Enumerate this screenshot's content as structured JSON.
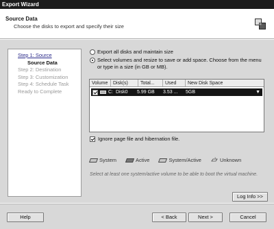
{
  "window": {
    "title": "Export Wizard"
  },
  "header": {
    "title": "Source Data",
    "subtitle": "Choose the disks to export and specify their size",
    "logo_icon": "wizard-logo-icon"
  },
  "steps": [
    {
      "label": "Step 1: Source",
      "state": "link"
    },
    {
      "label": "Source Data",
      "state": "current"
    },
    {
      "label": "Step 2: Destination",
      "state": "disabled"
    },
    {
      "label": "Step 3: Customization",
      "state": "disabled"
    },
    {
      "label": "Step 4: Schedule Task",
      "state": "disabled"
    },
    {
      "label": "Ready to Complete",
      "state": "disabled"
    }
  ],
  "options": {
    "export_all": {
      "label": "Export all disks and maintain size",
      "selected": false
    },
    "select_volumes": {
      "label": "Select volumes and resize to save or add space. Choose from the menu or type in a size (in GB or MB).",
      "selected": true
    }
  },
  "volume_table": {
    "columns": [
      "Volume",
      "Disk(s)",
      "Total...",
      "Used",
      "New Disk Space"
    ],
    "rows": [
      {
        "volume": "C:",
        "disk": "Disk0",
        "total": "5.99 GB",
        "used": "3.53 ...",
        "new_space": "5GB",
        "checked": true
      }
    ]
  },
  "ignore_page_file": {
    "label": "Ignore page file and hibernation file.",
    "checked": true
  },
  "legend": [
    {
      "label": "System",
      "icon": "system-volume-icon"
    },
    {
      "label": "Active",
      "icon": "active-volume-icon"
    },
    {
      "label": "System/Active",
      "icon": "system-active-volume-icon"
    },
    {
      "label": "Unknown",
      "icon": "unknown-volume-icon"
    }
  ],
  "note": "Select at least one system/active volume to be able to boot the virtual machine.",
  "buttons": {
    "log_info": "Log Info >>",
    "help": "Help",
    "back": "< Back",
    "next": "Next >",
    "cancel": "Cancel"
  },
  "colors": {
    "titlebar": "#1c1c1c",
    "selected_row": "#151515",
    "panel": "#d8d8d8"
  }
}
